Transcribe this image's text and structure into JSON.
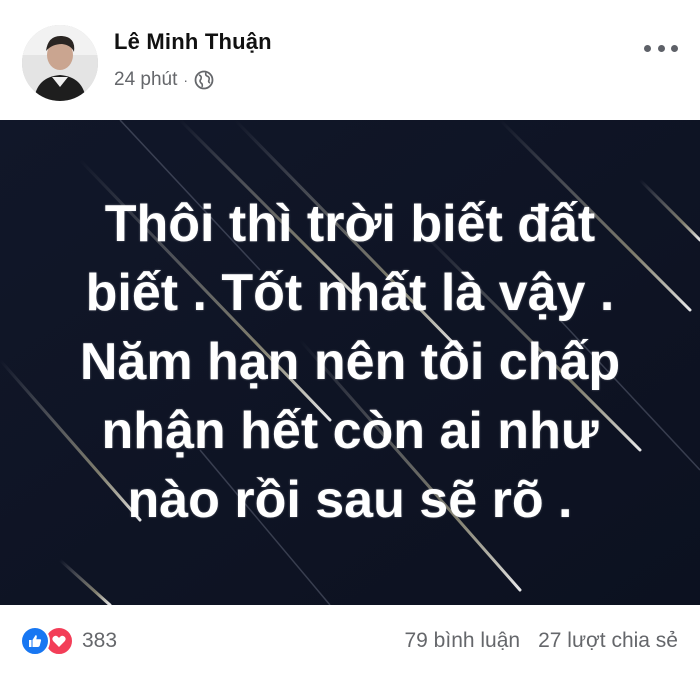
{
  "post": {
    "author": "Lê Minh Thuận",
    "time": "24 phút",
    "separator": "·",
    "privacy_icon": "globe-icon",
    "menu_icon": "more-options-icon",
    "text_lines": [
      "Thôi thì trời biết đất",
      "biết . Tốt nhất là vậy .",
      "Năm hạn nên tôi chấp",
      "nhận hết còn ai như",
      "nào rồi sau sẽ rõ ."
    ]
  },
  "footer": {
    "reaction_icons": [
      "like-icon",
      "love-icon"
    ],
    "reaction_count": "383",
    "comments": "79 bình luận",
    "shares": "27 lượt chia sẻ"
  },
  "colors": {
    "background": "#0f1426",
    "like": "#1877f2",
    "love": "#f33e58",
    "meta_text": "#65676b"
  }
}
